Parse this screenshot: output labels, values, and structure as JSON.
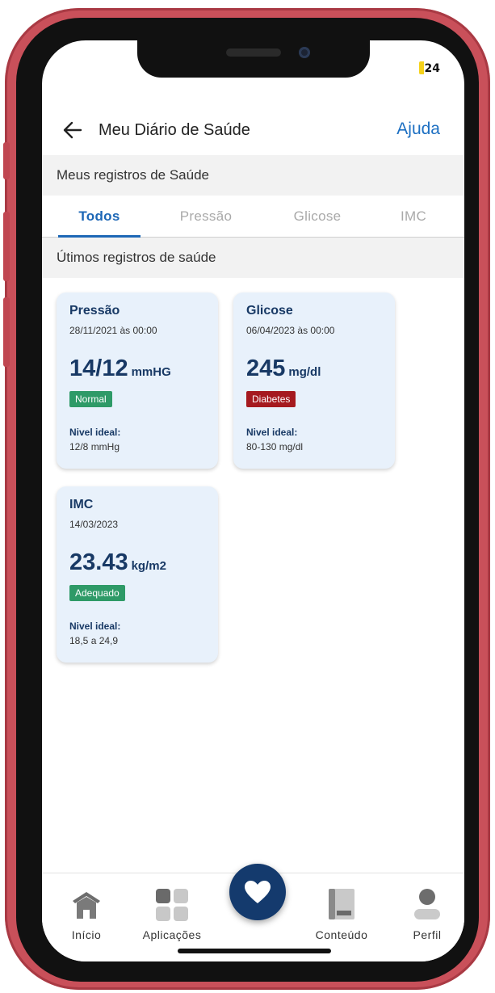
{
  "status_bar": {
    "battery": "24"
  },
  "header": {
    "title": "Meu Diário de Saúde",
    "help": "Ajuda"
  },
  "section_records": "Meus registros de Saúde",
  "tabs": [
    {
      "label": "Todos",
      "active": true
    },
    {
      "label": "Pressão",
      "active": false
    },
    {
      "label": "Glicose",
      "active": false
    },
    {
      "label": "IMC",
      "active": false
    }
  ],
  "section_latest": "Útimos registros de saúde",
  "cards": [
    {
      "title": "Pressão",
      "date": "28/11/2021 às 00:00",
      "value": "14/12",
      "unit": "mmHG",
      "status": "Normal",
      "status_color": "#2e9a67",
      "ideal_label": "Nivel ideal:",
      "ideal_value": "12/8 mmHg"
    },
    {
      "title": "Glicose",
      "date": "06/04/2023 às 00:00",
      "value": "245",
      "unit": "mg/dl",
      "status": "Diabetes",
      "status_color": "#a51a1f",
      "ideal_label": "Nivel ideal:",
      "ideal_value": "80-130 mg/dl"
    },
    {
      "title": "IMC",
      "date": "14/03/2023",
      "value": "23.43",
      "unit": "kg/m2",
      "status": "Adequado",
      "status_color": "#2e9a67",
      "ideal_label": "Nivel ideal:",
      "ideal_value": "18,5 a 24,9"
    }
  ],
  "nav": [
    {
      "label": "Início",
      "icon": "home-icon"
    },
    {
      "label": "Aplicações",
      "icon": "apps-grid-icon"
    },
    {
      "label": "",
      "icon": "heart-icon"
    },
    {
      "label": "Conteúdo",
      "icon": "book-icon"
    },
    {
      "label": "Perfil",
      "icon": "person-icon"
    }
  ],
  "colors": {
    "accent": "#1d67b6",
    "navy": "#183965",
    "card_bg": "#e8f1fb",
    "frame": "#c9505a"
  }
}
